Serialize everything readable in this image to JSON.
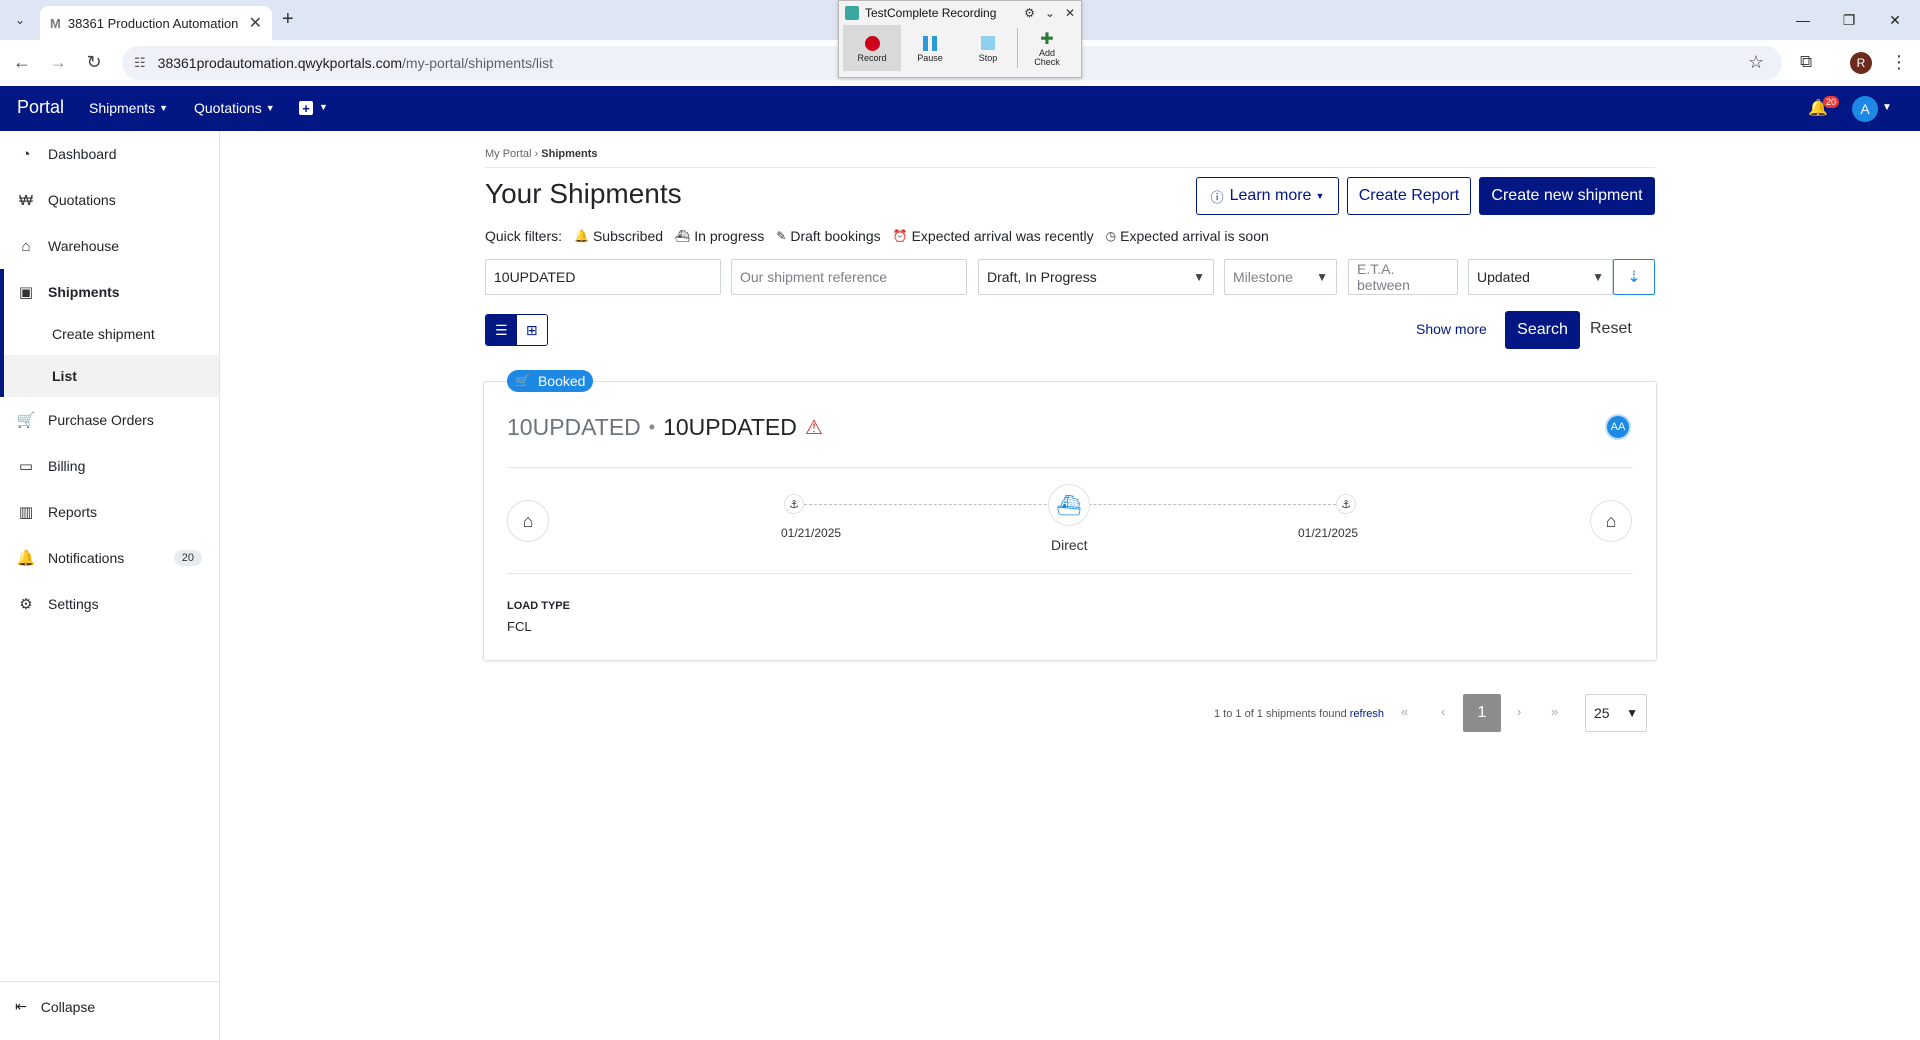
{
  "browser": {
    "tab_title": "38361 Production Automation",
    "tab_favicon": "M",
    "url_host": "38361prodautomation.qwykportals.com",
    "url_path": "/my-portal/shipments/list",
    "profile_initial": "R"
  },
  "testcomplete": {
    "title": "TestComplete Recording",
    "buttons": {
      "record": "Record",
      "pause": "Pause",
      "stop": "Stop",
      "add_check": "Add Check"
    }
  },
  "header": {
    "brand": "Portal",
    "nav": {
      "shipments": "Shipments",
      "quotations": "Quotations"
    },
    "notification_count": "20",
    "avatar_initial": "A"
  },
  "sidebar": {
    "items": {
      "dashboard": "Dashboard",
      "quotations": "Quotations",
      "warehouse": "Warehouse",
      "shipments": "Shipments",
      "create_shipment": "Create shipment",
      "list": "List",
      "purchase_orders": "Purchase Orders",
      "billing": "Billing",
      "reports": "Reports",
      "notifications": "Notifications",
      "settings": "Settings"
    },
    "notifications_badge": "20",
    "collapse": "Collapse"
  },
  "breadcrumb": {
    "root": "My Portal",
    "sep": "›",
    "current": "Shipments"
  },
  "page": {
    "title": "Your Shipments",
    "learn_more": "Learn more",
    "create_report": "Create Report",
    "create_new_shipment": "Create new shipment"
  },
  "quick_filters": {
    "label": "Quick filters:",
    "subscribed": "Subscribed",
    "in_progress": "In progress",
    "draft_bookings": "Draft bookings",
    "arrival_recently": "Expected arrival was recently",
    "arrival_soon": "Expected arrival is soon"
  },
  "filters": {
    "search_value": "10UPDATED",
    "reference_placeholder": "Our shipment reference",
    "status_value": "Draft, In Progress",
    "milestone_placeholder": "Milestone",
    "eta_placeholder": "E.T.A. between",
    "sort_value": "Updated"
  },
  "actions": {
    "show_more": "Show more",
    "search": "Search",
    "reset": "Reset"
  },
  "shipment": {
    "status": "Booked",
    "ref1": "10UPDATED",
    "ref2": "10UPDATED",
    "assignee_initials": "AA",
    "departure_date": "01/21/2025",
    "arrival_date": "01/21/2025",
    "mode": "Direct",
    "load_type_label": "LOAD TYPE",
    "load_type": "FCL"
  },
  "pagination": {
    "info": "1 to 1 of 1 shipments found",
    "refresh": "refresh",
    "current_page": "1",
    "page_size": "25"
  },
  "colors": {
    "brand": "#021783",
    "accent": "#1e88e5",
    "warning": "#d32f2f"
  }
}
